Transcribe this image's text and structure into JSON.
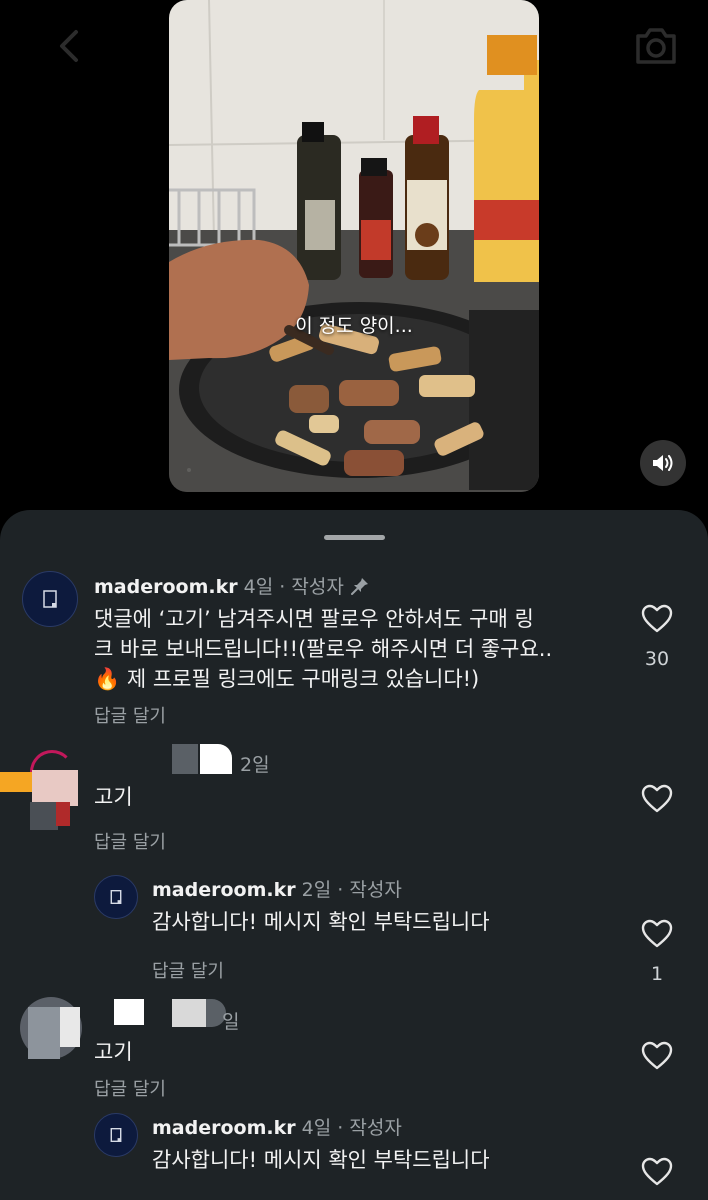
{
  "video": {
    "caption": "이 정도 양이..."
  },
  "comments": [
    {
      "username": "maderoom.kr",
      "time": "4일",
      "separator": "·",
      "author_label": "작성자",
      "text_lines": [
        "댓글에 ‘고기’ 남겨주시면 팔로우 안하셔도 구매 링",
        "크 바로 보내드립니다!!(팔로우 해주시면 더 좋구요..",
        "🔥 제 프로필 링크에도 구매링크 있습니다!)"
      ],
      "reply_label": "답글 달기",
      "likes": "30",
      "pinned": true
    },
    {
      "username": "",
      "time": "2일",
      "text": "고기",
      "reply_label": "답글 달기",
      "likes": ""
    },
    {
      "username": "maderoom.kr",
      "time": "2일",
      "separator": "·",
      "author_label": "작성자",
      "text": "감사합니다! 메시지 확인 부탁드립니다",
      "reply_label": "답글 달기",
      "likes": "1"
    },
    {
      "username": "",
      "time": "일",
      "text": "고기",
      "reply_label": "답글 달기",
      "likes": ""
    },
    {
      "username": "maderoom.kr",
      "time": "4일",
      "separator": "·",
      "author_label": "작성자",
      "text": "감사합니다! 메시지 확인 부탁드립니다",
      "reply_label": "",
      "likes": ""
    }
  ],
  "icons": {
    "back": "chevron-left-icon",
    "camera": "camera-icon",
    "mute": "speaker-icon",
    "pin": "pin-icon",
    "heart": "heart-icon"
  },
  "colors": {
    "sheet_background": "#1e2326",
    "secondary_text": "#9aa0a4",
    "avatar_background": "#0d1a3d"
  }
}
